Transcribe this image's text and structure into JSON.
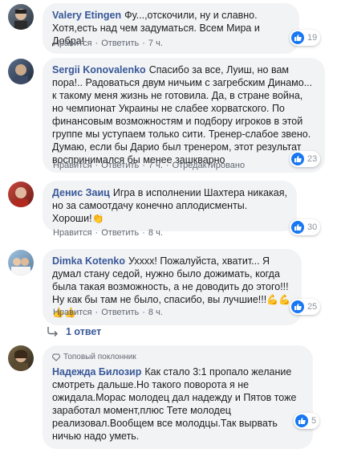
{
  "comments": [
    {
      "author": "Valery Etingen",
      "text": "Фу...,отскочили, ну и славно. Хотя,есть над чем задуматься. Всем Мира и Добра!",
      "actions": {
        "like": "Нравится",
        "reply": "Ответить",
        "time": "7 ч."
      },
      "reactions": "19"
    },
    {
      "author": "Sergii Konovalenko",
      "text": "Спасибо за все, Луиш, но вам пора!.. Радоваться двум ничьим с загребским Динамо... к такому меня жизнь не готовила. Да, в стране война, но чемпионат Украины не слабее хорватского. По финансовым возможностям и подбору игроков в этой группе мы уступаем только сити. Тренер-слабое звено. Думаю, если бы Дарио был тренером, этот результат воспринимался бы менее зашкварно",
      "actions": {
        "like": "Нравится",
        "reply": "Ответить",
        "time": "7 ч.",
        "edited": "Отредактировано"
      },
      "reactions": "23"
    },
    {
      "author": "Денис Заиц",
      "text": "Игра в исполнении Шахтера никакая, но за самоотдачу конечно аплодисменты.",
      "text2": "Хороши!",
      "actions": {
        "like": "Нравится",
        "reply": "Ответить",
        "time": "8 ч."
      },
      "reactions": "30"
    },
    {
      "author": "Dimka Kotenko",
      "text": "Ухххх! Пожалуйста, хватит... Я думал стану седой, нужно было дожимать, когда была такая возможность, а не доводить до этого!!! Ну как бы там не было, спасибо, вы лучшие!!!",
      "actions": {
        "like": "Нравится",
        "reply": "Ответить",
        "time": "8 ч."
      },
      "reactions": "25",
      "replies": "1 ответ"
    },
    {
      "badge": "Топовый поклонник",
      "author": "Надежда Билозир",
      "text": "Как стало 3:1 пропало желание смотреть дальше.Но такого поворота я не ожидала.Морас молодец дал надежду и Пятов тоже заработал момент,плюс Тете молодец реализовал.Вообщем все молодцы.Так вырвать ничью надо уметь.",
      "reactions": "5"
    }
  ],
  "colors": {
    "link": "#385898",
    "bubble": "#f2f3f5",
    "like": "#1877f2",
    "meta": "#606770"
  },
  "icons": [
    "like-icon",
    "clap-emoji-icon",
    "flex-emoji-icon",
    "reply-arrow-icon",
    "diamond-icon"
  ]
}
